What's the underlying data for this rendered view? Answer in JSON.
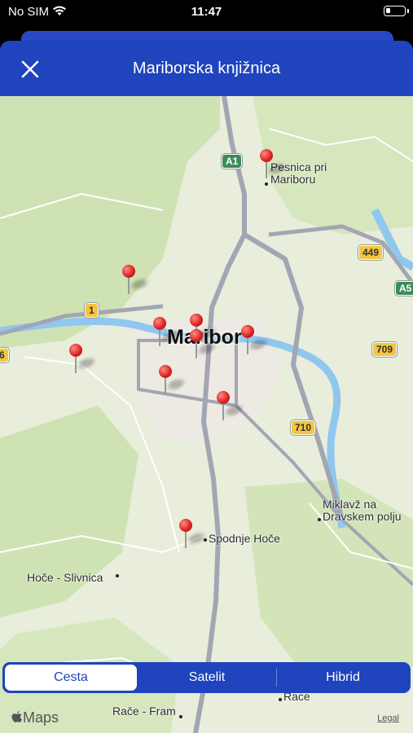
{
  "status_bar": {
    "carrier": "No SIM",
    "time": "11:47"
  },
  "header": {
    "title": "Mariborska knjižnica",
    "close_icon": "close-icon"
  },
  "map": {
    "city_label": "Maribor",
    "place_labels": {
      "pesnica": "Pesnica pri\nMariboru",
      "miklavz": "Miklavž na\nDravskem polju",
      "spodnje_hoce": "Spodnje Hoče",
      "hoce_slivnica": "Hoče - Slivnica",
      "race": "Race",
      "race_fram": "Rače - Fram"
    },
    "road_shields": {
      "a1": "A1",
      "r449": "449",
      "a5": "A5",
      "r1": "1",
      "r709": "709",
      "r710": "710",
      "r6": "6"
    },
    "pin_count": 11
  },
  "segmented_control": {
    "options": [
      "Cesta",
      "Satelit",
      "Hibrid"
    ],
    "selected": "Cesta"
  },
  "attribution": {
    "logo_text": "Maps",
    "legal": "Legal"
  },
  "colors": {
    "accent": "#1f44bd",
    "pin": "#d81f1f",
    "water": "#8fc7ef"
  }
}
